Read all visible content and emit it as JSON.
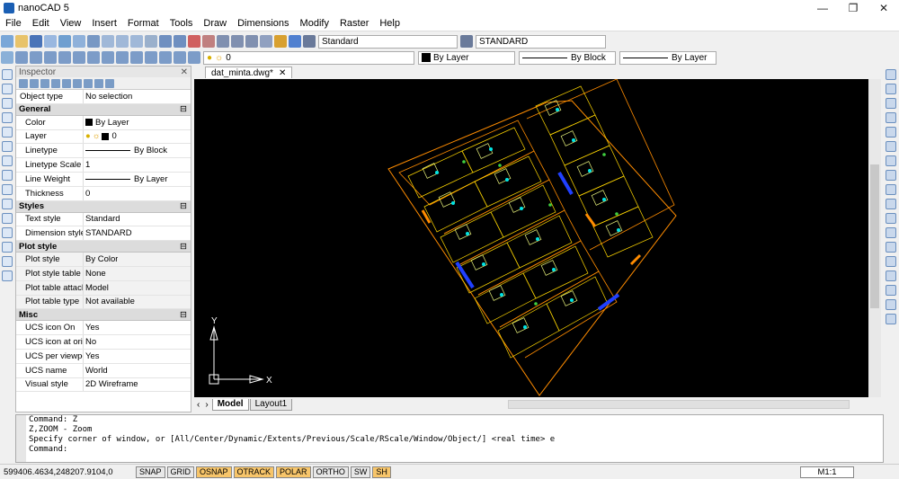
{
  "window": {
    "title": "nanoCAD 5",
    "controls": [
      "—",
      "❐",
      "✕"
    ]
  },
  "menu": [
    "File",
    "Edit",
    "View",
    "Insert",
    "Format",
    "Tools",
    "Draw",
    "Dimensions",
    "Modify",
    "Raster",
    "Help"
  ],
  "toolbar": {
    "text_style": "Standard",
    "dim_style": "STANDARD",
    "layer": "0",
    "color": "By Layer",
    "linetype": "By Block",
    "lineweight": "By Layer"
  },
  "inspector": {
    "title": "Inspector",
    "object_type_label": "Object type",
    "object_type_value": "No selection",
    "sections": [
      {
        "title": "General",
        "rows": [
          {
            "k": "Color",
            "v": "By Layer"
          },
          {
            "k": "Layer",
            "v": "0"
          },
          {
            "k": "Linetype",
            "v": "By Block"
          },
          {
            "k": "Linetype Scale",
            "v": "1"
          },
          {
            "k": "Line Weight",
            "v": "By Layer"
          },
          {
            "k": "Thickness",
            "v": "0"
          }
        ]
      },
      {
        "title": "Styles",
        "rows": [
          {
            "k": "Text style",
            "v": "Standard"
          },
          {
            "k": "Dimension style",
            "v": "STANDARD"
          }
        ]
      },
      {
        "title": "Plot style",
        "rows": [
          {
            "k": "Plot style",
            "v": "By Color"
          },
          {
            "k": "Plot style table",
            "v": "None"
          },
          {
            "k": "Plot table attach...",
            "v": "Model"
          },
          {
            "k": "Plot table type",
            "v": "Not available"
          }
        ]
      },
      {
        "title": "Misc",
        "rows": [
          {
            "k": "UCS icon On",
            "v": "Yes"
          },
          {
            "k": "UCS icon at origin",
            "v": "No"
          },
          {
            "k": "UCS per viewport",
            "v": "Yes"
          },
          {
            "k": "UCS name",
            "v": "World"
          },
          {
            "k": "Visual style",
            "v": "2D Wireframe"
          }
        ]
      }
    ]
  },
  "document": {
    "tab": "dat_minta.dwg*",
    "tab_close": "✕"
  },
  "layout_tabs": {
    "model": "Model",
    "layout1": "Layout1"
  },
  "ucs": {
    "y": "Y",
    "x": "X"
  },
  "command": {
    "lines": [
      "Command: Z",
      "Z,ZOOM - Zoom",
      "Specify corner of window, or [All/Center/Dynamic/Extents/Previous/Scale/RScale/Window/Object/] <real time> e",
      "Command:"
    ]
  },
  "status": {
    "coords": "599406.4634,248207.9104,0",
    "toggles": [
      {
        "label": "SNAP",
        "on": false
      },
      {
        "label": "GRID",
        "on": false
      },
      {
        "label": "OSNAP",
        "on": true
      },
      {
        "label": "OTRACK",
        "on": true
      },
      {
        "label": "POLAR",
        "on": true
      },
      {
        "label": "ORTHO",
        "on": false
      },
      {
        "label": "SW",
        "on": false
      },
      {
        "label": "SH",
        "on": true
      }
    ],
    "scale": "M1:1"
  },
  "colors": {
    "viewport_bg": "#000000",
    "boundary": "#ff8c00",
    "parcel": "#ffd700",
    "building": "#e6f07a",
    "street": "#2040ff",
    "accent": "#f7c56a"
  }
}
